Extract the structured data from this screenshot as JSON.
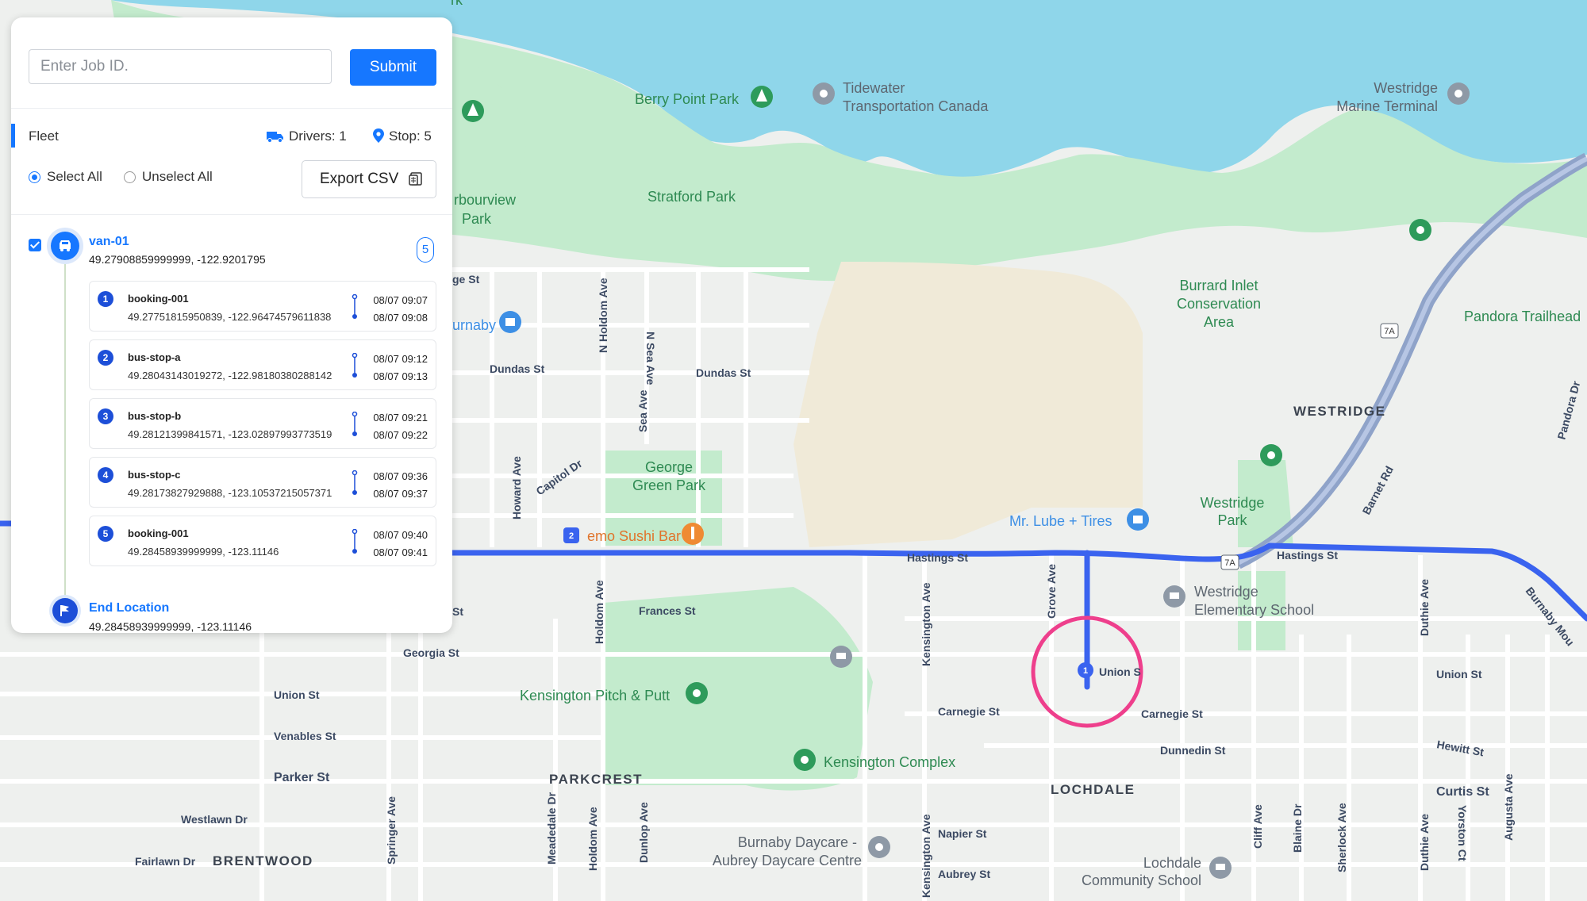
{
  "search": {
    "placeholder": "Enter Job ID.",
    "submit_label": "Submit"
  },
  "fleet": {
    "label": "Fleet",
    "drivers": "Drivers: 1",
    "stops": "Stop: 5",
    "select_all": "Select All",
    "unselect_all": "Unselect All",
    "export_label": "Export CSV"
  },
  "vehicle": {
    "name": "van-01",
    "coords": "49.27908859999999, -122.9201795",
    "stop_count": "5",
    "stops": [
      {
        "num": "1",
        "name": "booking-001",
        "coords": "49.27751815950839, -122.96474579611838",
        "arrive": "08/07 09:07",
        "depart": "08/07 09:08"
      },
      {
        "num": "2",
        "name": "bus-stop-a",
        "coords": "49.28043143019272, -122.98180380288142",
        "arrive": "08/07 09:12",
        "depart": "08/07 09:13"
      },
      {
        "num": "3",
        "name": "bus-stop-b",
        "coords": "49.28121399841571, -123.02897993773519",
        "arrive": "08/07 09:21",
        "depart": "08/07 09:22"
      },
      {
        "num": "4",
        "name": "bus-stop-c",
        "coords": "49.28173827929888, -123.10537215057371",
        "arrive": "08/07 09:36",
        "depart": "08/07 09:37"
      },
      {
        "num": "5",
        "name": "booking-001",
        "coords": "49.28458939999999, -123.11146",
        "arrive": "08/07 09:40",
        "depart": "08/07 09:41"
      }
    ],
    "end_name": "End Location",
    "end_coords": "49.28458939999999, -123.11146"
  },
  "map": {
    "colors": {
      "water": "#8fd6ea",
      "park": "#bfe8c9",
      "route": "#3a63ef",
      "highlight": "#ee3f8c",
      "land": "#eef0ee"
    },
    "markers": {
      "stop_1": "1",
      "stop_2": "2"
    },
    "places": {
      "berry_point": "Berry Point Park",
      "tidewater_1": "Tidewater",
      "tidewater_2": "Transportation Canada",
      "westridge_mt_1": "Westridge",
      "westridge_mt_2": "Marine Terminal",
      "stratford": "Stratford Park",
      "harbourview_1": "rbourview",
      "harbourview_2": "Park",
      "burrard_1": "Burrard Inlet",
      "burrard_2": "Conservation",
      "burrard_3": "Area",
      "pandora": "Pandora Trailhead",
      "westridge": "WESTRIDGE",
      "george_1": "George",
      "george_2": "Green Park",
      "mrlube": "Mr. Lube + Tires",
      "westridge_park_1": "Westridge",
      "westridge_park_2": "Park",
      "sushi": "emo Sushi Bar",
      "westridge_elem_1": "Westridge",
      "westridge_elem_2": "Elementary School",
      "kensington_pp": "Kensington Pitch & Putt",
      "kensington_cx": "Kensington Complex",
      "parkcrest": "PARKCREST",
      "lochdale": "LOCHDALE",
      "brentwood": "BRENTWOOD",
      "daycare_1": "Burnaby Daycare -",
      "daycare_2": "Aubrey Daycare Centre",
      "lochdale_cs_1": "Lochdale",
      "lochdale_cs_2": "Community School",
      "urnaby": "urnaby",
      "rk_top": "rk"
    },
    "streets": {
      "dundas_1": "Dundas St",
      "dundas_2": "Dundas St",
      "hastings_1": "Hastings St",
      "hastings_2": "Hastings St",
      "union_1": "Union St",
      "union_2": "Union S",
      "union_3": "Union St",
      "venables": "Venables St",
      "parker": "Parker St",
      "westlawn": "Westlawn Dr",
      "fairlawn": "Fairlawn Dr",
      "georgia": "Georgia St",
      "frances": "Frances St",
      "carnegie_1": "Carnegie St",
      "carnegie_2": "Carnegie St",
      "dunnedin": "Dunnedin St",
      "napier": "Napier St",
      "aubrey": "Aubrey St",
      "hewitt": "Hewitt St",
      "curtis": "Curtis St",
      "n_holdom": "N Holdom Ave",
      "n_sea": "N Sea Ave",
      "sea": "Sea Ave",
      "howard": "Howard Ave",
      "capitol": "Capitol Dr",
      "holdom_1": "Holdom Ave",
      "holdom_2": "Holdom Ave",
      "kensington_1": "Kensington Ave",
      "kensington_2": "Kensington Ave",
      "grove": "Grove Ave",
      "cliff": "Cliff Ave",
      "blaine": "Blaine Dr",
      "sherlock": "Sherlock Ave",
      "duthie_1": "Duthie Ave",
      "duthie_2": "Duthie Ave",
      "yorston": "Yorston Ct",
      "augusta": "Augusta Ave",
      "springer": "Springer Ave",
      "meadedale": "Meadedale Dr",
      "dunlop": "Dunlop Ave",
      "barnet": "Barnet Rd",
      "pandora_dr": "Pandora Dr",
      "burnaby_mtn": "Burnaby Mou",
      "hwy_7a_1": "7A",
      "hwy_7a_2": "7A",
      "ge_st": "ge St",
      "st_frag": "St"
    }
  }
}
